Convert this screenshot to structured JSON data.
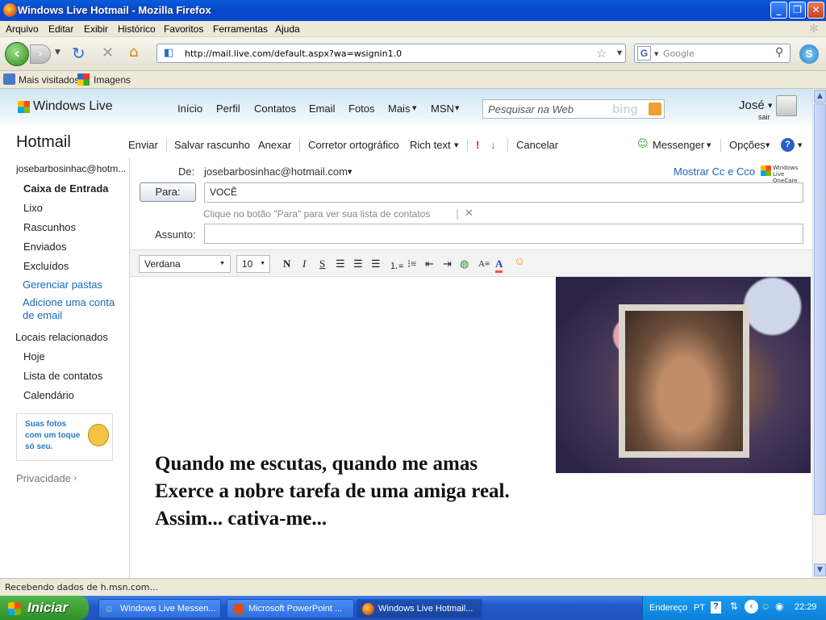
{
  "window": {
    "title": "Windows Live Hotmail - Mozilla Firefox"
  },
  "menu": [
    "Arquivo",
    "Editar",
    "Exibir",
    "Histórico",
    "Favoritos",
    "Ferramentas",
    "Ajuda"
  ],
  "nav": {
    "url": "http://mail.live.com/default.aspx?wa=wsignin1.0",
    "search_placeholder": "Google"
  },
  "bookmarks": [
    "Mais visitados",
    "Imagens"
  ],
  "live": {
    "logo": "Windows Live",
    "links": [
      "Início",
      "Perfil",
      "Contatos",
      "Email",
      "Fotos",
      "Mais",
      "MSN"
    ],
    "search_placeholder": "Pesquisar na Web",
    "bing": "bing",
    "user": "José",
    "signout": "sair"
  },
  "hotmail": {
    "title": "Hotmail"
  },
  "toolbar": {
    "send": "Enviar",
    "save_draft": "Salvar rascunho",
    "attach": "Anexar",
    "spell": "Corretor ortográfico",
    "rich_text": "Rich text",
    "cancel": "Cancelar",
    "messenger": "Messenger",
    "options": "Opções"
  },
  "sidebar": {
    "account": "josebarbosinhac@hotm...",
    "folders": [
      "Caixa de Entrada",
      "Lixo",
      "Rascunhos",
      "Enviados",
      "Excluídos"
    ],
    "manage": "Gerenciar pastas",
    "add_account": "Adicione uma conta de email",
    "related_heading": "Locais relacionados",
    "related": [
      "Hoje",
      "Lista de contatos",
      "Calendário"
    ],
    "ad": "Suas fotos com um toque só seu.",
    "privacy": "Privacidade"
  },
  "compose": {
    "from_label": "De:",
    "from_value": "josebarbosinhac@hotmail.com",
    "show_cc": "Mostrar Cc e Cco",
    "onecare": "Windows Live OneCare",
    "to_button": "Para:",
    "to_value": "VOCÊ",
    "hint": "Clique no botão \"Para\" para ver sua lista de contatos",
    "subject_label": "Assunto:",
    "subject_value": "",
    "font": "Verdana",
    "size": "10",
    "poem": [
      "Quando me escutas, quando me amas",
      "Exerce a nobre tarefa de uma amiga real.",
      "Assim... cativa-me..."
    ]
  },
  "status": "Recebendo dados de h.msn.com...",
  "taskbar": {
    "start": "Iniciar",
    "tasks": [
      "Windows Live Messen...",
      "Microsoft PowerPoint ...",
      "Windows Live Hotmail..."
    ],
    "address": "Endereço",
    "lang": "PT",
    "time": "22:29"
  }
}
